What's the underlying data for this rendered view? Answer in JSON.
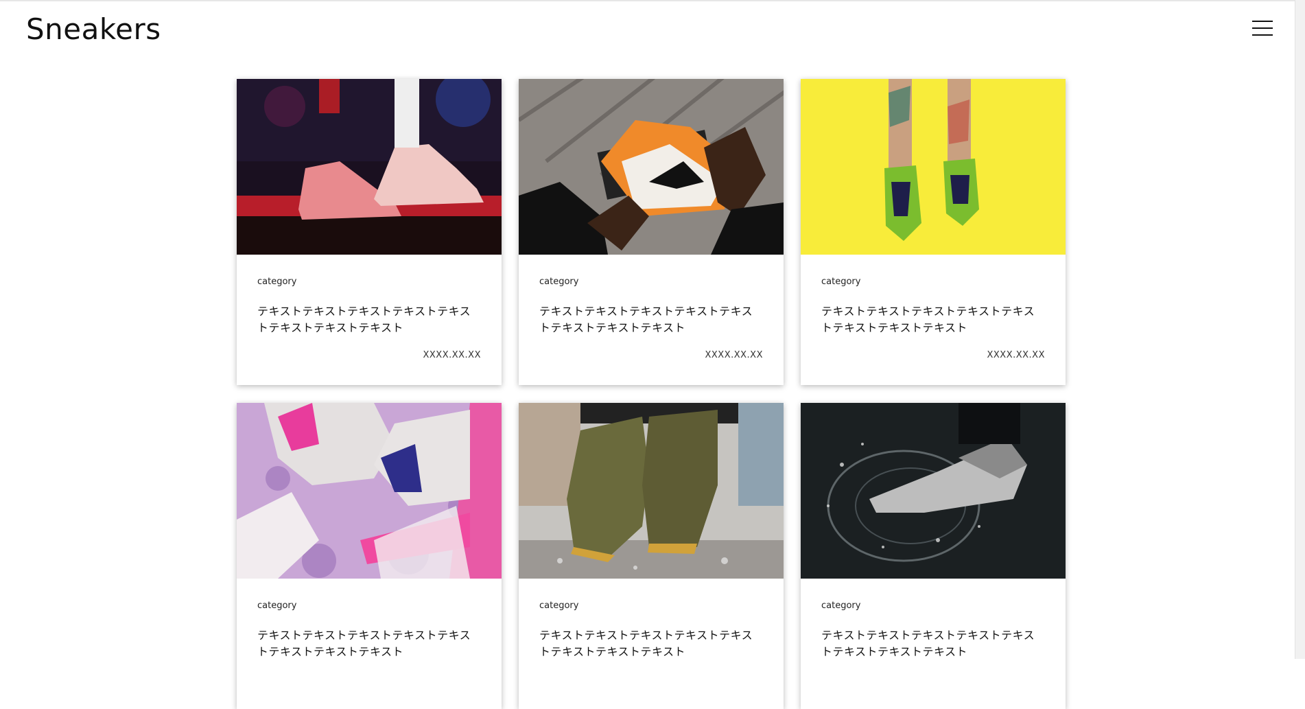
{
  "header": {
    "logo": "Sneakers",
    "menu_icon": "hamburger-menu-icon"
  },
  "cards": [
    {
      "category": "category",
      "title": "テキストテキストテキストテキストテキストテキストテキストテキスト",
      "date": "XXXX.XX.XX",
      "image": "sneakers-on-stage-photo"
    },
    {
      "category": "category",
      "title": "テキストテキストテキストテキストテキストテキストテキストテキスト",
      "date": "XXXX.XX.XX",
      "image": "hands-holding-sneaker-photo"
    },
    {
      "category": "category",
      "title": "テキストテキストテキストテキストテキストテキストテキストテキスト",
      "date": "XXXX.XX.XX",
      "image": "green-sneakers-yellow-background-photo"
    },
    {
      "category": "category",
      "title": "テキストテキストテキストテキストテキストテキストテキストテキスト",
      "date": "",
      "image": "pink-air-sneakers-photo"
    },
    {
      "category": "category",
      "title": "テキストテキストテキストテキストテキストテキストテキストテキスト",
      "date": "",
      "image": "olive-boots-splash-photo"
    },
    {
      "category": "category",
      "title": "テキストテキストテキストテキストテキストテキストテキストテキスト",
      "date": "",
      "image": "sneaker-water-splash-photo"
    }
  ]
}
